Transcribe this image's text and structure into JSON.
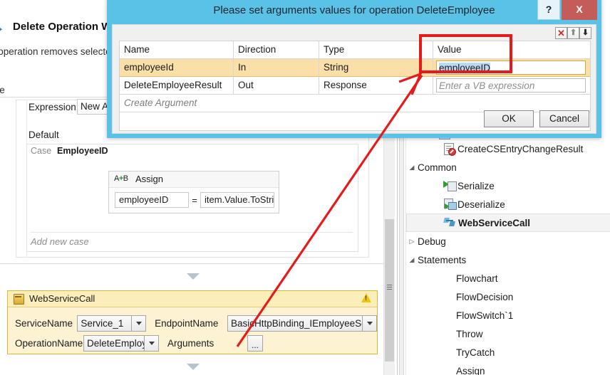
{
  "designer": {
    "header_title": "Delete Operation Wo",
    "header_icon": "workflow-icon",
    "description": "e operation removes selected",
    "description2": "ete",
    "switch": {
      "expression_label": "Expression",
      "expression_value": "New Ar",
      "default_label": "Default",
      "case_keyword": "Case",
      "case_value": "EmployeeID",
      "add_new_case": "Add new case"
    },
    "assign": {
      "icon": "assign-ab-icon",
      "icon_text": "A B",
      "title": "Assign",
      "to_value": "employeeID",
      "operator": "=",
      "from_value": "item.Value.ToStrin"
    },
    "webservicecall": {
      "title": "WebServiceCall",
      "icon": "activity-icon",
      "warning_icon": "warning-icon",
      "warning_glyph": "!",
      "fields": [
        {
          "label": "ServiceName",
          "value": "Service_1",
          "control": "combobox"
        },
        {
          "label": "EndpointName",
          "value": "BasicHttpBinding_IEmployeeService",
          "control": "combobox"
        },
        {
          "label": "OperationName",
          "value": "DeleteEmployee",
          "control": "combobox"
        },
        {
          "label": "Arguments",
          "value": "...",
          "control": "ellipsis-button"
        }
      ]
    }
  },
  "toolbox": {
    "items": [
      {
        "label": "CreateCSEntryChangeResult",
        "indent": 2,
        "icon": "document-error-icon",
        "twisty": "",
        "selected": false,
        "bold": false
      },
      {
        "label": "Common",
        "indent": 0,
        "icon": "",
        "twisty": "◢",
        "selected": false,
        "bold": false
      },
      {
        "label": "Serialize",
        "indent": 2,
        "icon": "serialize-icon",
        "twisty": "",
        "selected": false,
        "bold": false
      },
      {
        "label": "Deserialize",
        "indent": 2,
        "icon": "deserialize-icon",
        "twisty": "",
        "selected": false,
        "bold": false
      },
      {
        "label": "WebServiceCall",
        "indent": 2,
        "icon": "webservice-icon",
        "twisty": "",
        "selected": true,
        "bold": true
      },
      {
        "label": "Debug",
        "indent": 0,
        "icon": "",
        "twisty": "▷",
        "selected": false,
        "bold": false
      },
      {
        "label": "Statements",
        "indent": 0,
        "icon": "",
        "twisty": "◢",
        "selected": false,
        "bold": false
      },
      {
        "label": "Flowchart",
        "indent": 3,
        "icon": "",
        "twisty": "",
        "selected": false,
        "bold": false
      },
      {
        "label": "FlowDecision",
        "indent": 3,
        "icon": "",
        "twisty": "",
        "selected": false,
        "bold": false
      },
      {
        "label": "FlowSwitch`1",
        "indent": 3,
        "icon": "",
        "twisty": "",
        "selected": false,
        "bold": false
      },
      {
        "label": "Throw",
        "indent": 3,
        "icon": "",
        "twisty": "",
        "selected": false,
        "bold": false
      },
      {
        "label": "TryCatch",
        "indent": 3,
        "icon": "",
        "twisty": "",
        "selected": false,
        "bold": false
      },
      {
        "label": "Assign",
        "indent": 3,
        "icon": "",
        "twisty": "",
        "selected": false,
        "bold": false
      }
    ]
  },
  "dialog": {
    "title": "Please set arguments values for operation DeleteEmployee",
    "help_label": "?",
    "close_label": "X",
    "toolbar": {
      "delete_label": "✕",
      "move_up_label": "⬆",
      "move_down_label": "⬇"
    },
    "grid": {
      "columns": [
        "Name",
        "Direction",
        "Type",
        "Value"
      ],
      "rows": [
        {
          "name": "employeeId",
          "direction": "In",
          "type": "String",
          "value": "employeeID",
          "value_is_placeholder": false,
          "selected": true
        },
        {
          "name": "DeleteEmployeeResult",
          "direction": "Out",
          "type": "Response",
          "value": "Enter a VB expression",
          "value_is_placeholder": true,
          "selected": false
        }
      ],
      "create_row_label": "Create Argument"
    },
    "ok_label": "OK",
    "cancel_label": "Cancel"
  },
  "annotations": {
    "highlight_color": "#e51b1b",
    "rectangle_target": "value-cell-employeeID",
    "arrow_from": "arguments-ellipsis-button",
    "arrow_to": "value-cell-employeeID"
  }
}
